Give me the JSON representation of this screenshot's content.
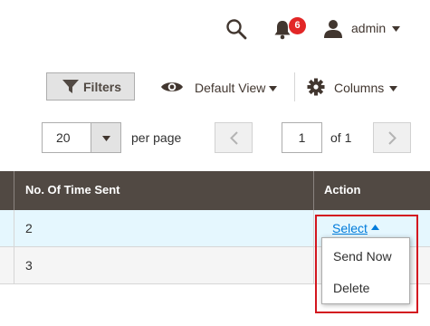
{
  "header": {
    "notification_count": "6",
    "user_label": "admin",
    "icons": [
      "search-icon",
      "bell-icon",
      "user-icon",
      "caret-down-icon"
    ]
  },
  "toolbar": {
    "filters_label": "Filters",
    "view_label": "Default View",
    "columns_label": "Columns"
  },
  "pagination": {
    "per_page_value": "20",
    "per_page_label": "per page",
    "current_page": "1",
    "total_pages_label": "of 1"
  },
  "table": {
    "columns": [
      "No. Of Time Sent",
      "Action"
    ],
    "rows": [
      {
        "sent": "2",
        "action": "Select"
      },
      {
        "sent": "3",
        "action": ""
      }
    ]
  },
  "action_menu": {
    "items": [
      "Send Now",
      "Delete"
    ]
  },
  "colors": {
    "table_header": "#514943",
    "link": "#007bdb",
    "badge": "#e22626",
    "highlight": "#d3161f"
  }
}
